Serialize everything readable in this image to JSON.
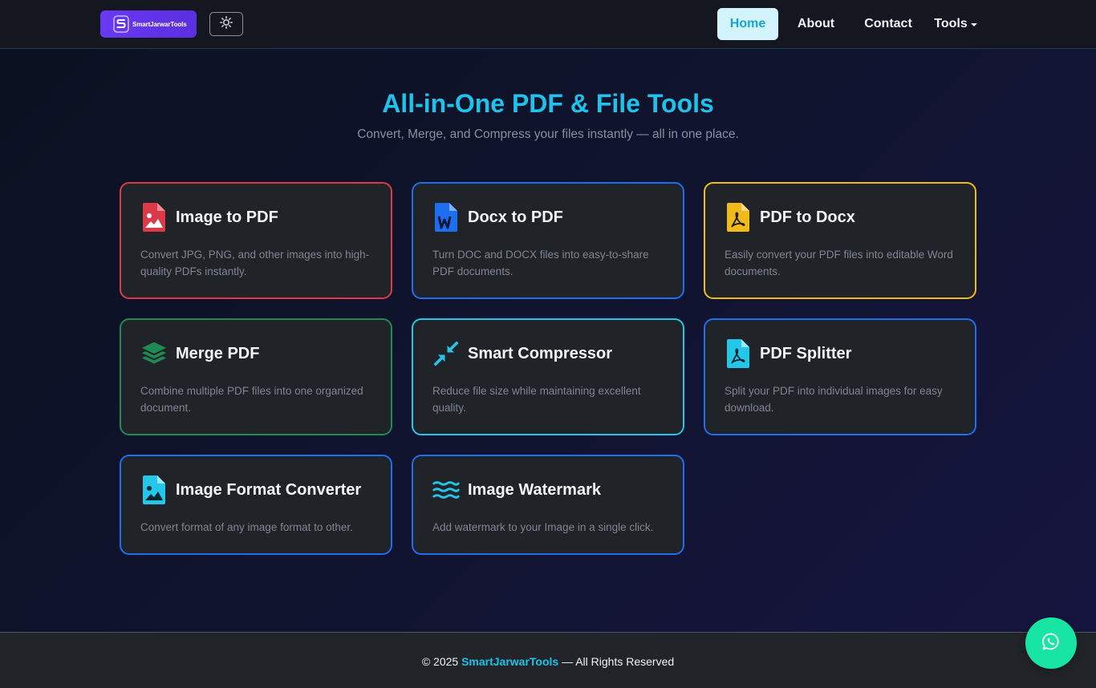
{
  "navbar": {
    "logo_text": "SmartJarwarTools",
    "links": [
      {
        "label": "Home",
        "active": true
      },
      {
        "label": "About"
      },
      {
        "label": "Contact"
      },
      {
        "label": "Tools"
      }
    ]
  },
  "hero": {
    "title": "All-in-One PDF & File Tools",
    "subtitle": "Convert, Merge, and Compress your files instantly — all in one place."
  },
  "cards": [
    {
      "title": "Image to PDF",
      "desc": "Convert JPG, PNG, and other images into high-quality PDFs instantly.",
      "icon": "file-image-icon",
      "color": "#dc3a48"
    },
    {
      "title": "Docx to PDF",
      "desc": "Turn DOC and DOCX files into easy-to-share PDF documents.",
      "icon": "file-word-icon",
      "color": "#1d6ff0"
    },
    {
      "title": "PDF to Docx",
      "desc": "Easily convert your PDF files into editable Word documents.",
      "icon": "file-pdf-icon",
      "color": "#f0bb1a"
    },
    {
      "title": "Merge PDF",
      "desc": "Combine multiple PDF files into one organized document.",
      "icon": "layers-icon",
      "color": "#1f8a53"
    },
    {
      "title": "Smart Compressor",
      "desc": "Reduce file size while maintaining excellent quality.",
      "icon": "compress-arrows-icon",
      "color": "#24c7ea"
    },
    {
      "title": "PDF Splitter",
      "desc": "Split your PDF into individual images for easy download.",
      "icon": "file-pdf-icon",
      "color": "#1d6ff0"
    },
    {
      "title": "Image Format Converter",
      "desc": "Convert format of any image format to other.",
      "icon": "file-image-icon",
      "color": "#1d6ff0"
    },
    {
      "title": "Image Watermark",
      "desc": "Add watermark to your Image in a single click.",
      "icon": "water-waves-icon",
      "color": "#1d6ff0"
    }
  ],
  "footer": {
    "prefix": "© 2025 ",
    "brand": "SmartJarwarTools",
    "suffix": " — All Rights Reserved"
  },
  "floating": {
    "icon": "whatsapp-icon",
    "color": "#18e5a4"
  }
}
